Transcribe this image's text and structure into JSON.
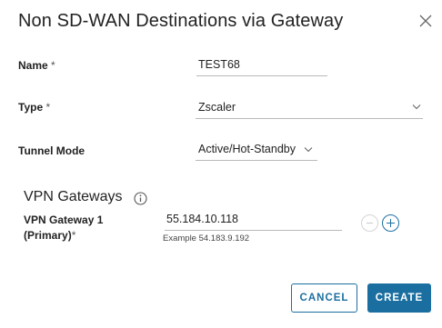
{
  "dialog": {
    "title": "Non SD-WAN Destinations via Gateway",
    "close_icon": "close-icon"
  },
  "form": {
    "name": {
      "label": "Name",
      "required_mark": " *",
      "value": "TEST68"
    },
    "type": {
      "label": "Type",
      "required_mark": " *",
      "value": "Zscaler"
    },
    "tunnel_mode": {
      "label": "Tunnel Mode",
      "value": "Active/Hot-Standby"
    }
  },
  "vpn": {
    "section_title": "VPN Gateways",
    "info_icon": "info-icon",
    "gateway1": {
      "label_line1": "VPN Gateway 1",
      "label_line2": "(Primary)",
      "required_mark": "*",
      "value": "55.184.10.118",
      "hint": "Example 54.183.9.192"
    }
  },
  "footer": {
    "cancel_label": "CANCEL",
    "create_label": "CREATE"
  },
  "colors": {
    "accent": "#1b6fa0",
    "text": "#222222",
    "border": "#b8b8b8"
  }
}
